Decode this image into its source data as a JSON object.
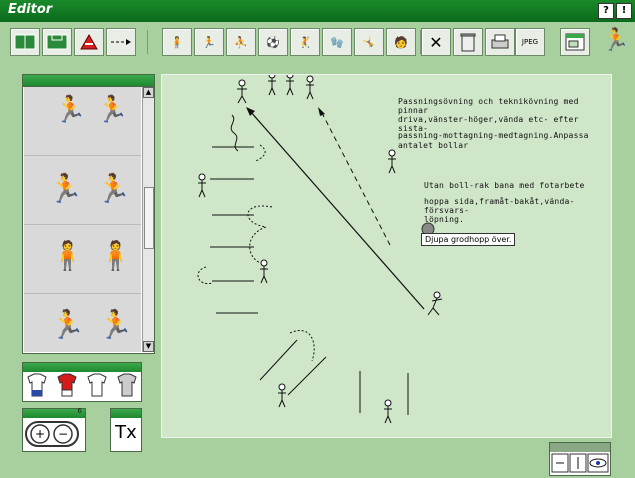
{
  "window": {
    "title": "Editor",
    "help_label": "?",
    "alert_label": "!"
  },
  "toolbar": {
    "jpeg_label": "JPEG"
  },
  "sidebar": {
    "zoom_small_label": "6"
  },
  "text_tool": {
    "label": "Tx"
  },
  "canvas": {
    "notes": [
      "Passningsövning och teknikövning med pinnar",
      "driva,vänster-höger,vända etc- efter sista-",
      "passning-mottagning-medtagning.Anpassa",
      "antalet bollar",
      "Utan boll-rak bana med fotarbete",
      "hoppa sida,framåt-bakåt,vända-försvars-",
      "löpning."
    ],
    "tooltip": "Djupa grodhopp över."
  },
  "colors": {
    "accent": "#1a8a2a",
    "background": "#a8cf9e",
    "field": "#cfe6c9"
  }
}
